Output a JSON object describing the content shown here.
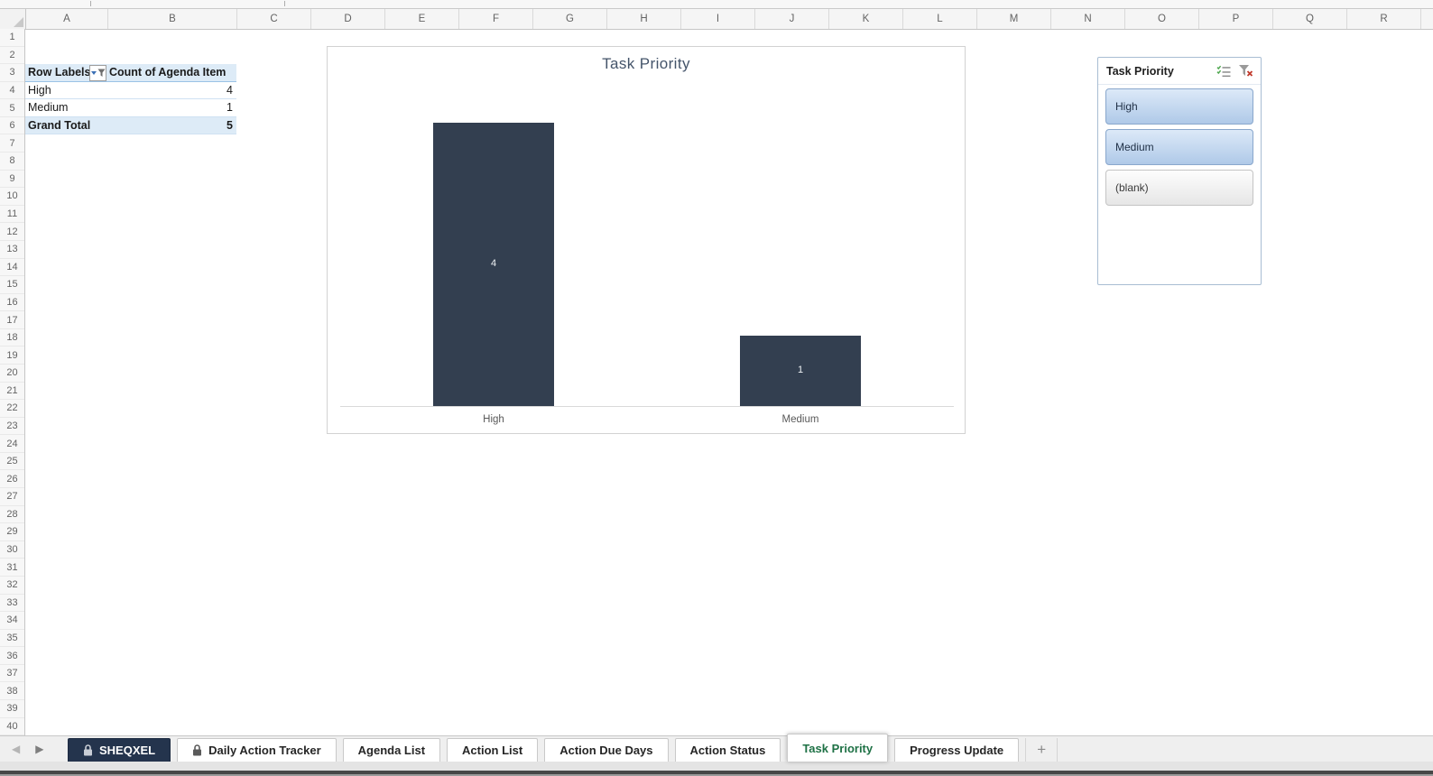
{
  "grid": {
    "columns": [
      "A",
      "B",
      "C",
      "D",
      "E",
      "F",
      "G",
      "H",
      "I",
      "J",
      "K",
      "L",
      "M",
      "N",
      "O",
      "P",
      "Q",
      "R"
    ],
    "rows": [
      1,
      2,
      3,
      4,
      5,
      6,
      7,
      8,
      9,
      10,
      11,
      12,
      13,
      14,
      15,
      16,
      17,
      18,
      19,
      20,
      21,
      22,
      23,
      24,
      25,
      26,
      27,
      28,
      29,
      30,
      31,
      32,
      33,
      34,
      35,
      36,
      37,
      38,
      39,
      40
    ]
  },
  "pivot": {
    "header": {
      "row_label": "Row Labels",
      "value_label": "Count of Agenda Item"
    },
    "rows": [
      {
        "label": "High",
        "value": "4"
      },
      {
        "label": "Medium",
        "value": "1"
      }
    ],
    "total": {
      "label": "Grand Total",
      "value": "5"
    }
  },
  "chart_data": {
    "type": "bar",
    "title": "Task Priority",
    "categories": [
      "High",
      "Medium"
    ],
    "values": [
      4,
      1
    ],
    "data_labels": [
      4,
      1
    ],
    "xlabel": "",
    "ylabel": "",
    "ylim": [
      0,
      4
    ],
    "gridlines": false,
    "y_axis_visible": false,
    "legend": "none",
    "bar_color": "#333F50"
  },
  "slicer": {
    "title": "Task Priority",
    "icons": [
      "multi-select-icon",
      "clear-filter-icon"
    ],
    "items": [
      {
        "label": "High",
        "selected": true
      },
      {
        "label": "Medium",
        "selected": true
      },
      {
        "label": "(blank)",
        "selected": false
      }
    ]
  },
  "sheet_tabs": {
    "tabs": [
      {
        "label": "SHEQXEL",
        "locked": true,
        "dark": true,
        "active": false
      },
      {
        "label": "Daily Action Tracker",
        "locked": true,
        "dark": false,
        "active": false
      },
      {
        "label": "Agenda List",
        "locked": false,
        "dark": false,
        "active": false
      },
      {
        "label": "Action List",
        "locked": false,
        "dark": false,
        "active": false
      },
      {
        "label": "Action Due Days",
        "locked": false,
        "dark": false,
        "active": false
      },
      {
        "label": "Action Status",
        "locked": false,
        "dark": false,
        "active": false
      },
      {
        "label": "Task Priority",
        "locked": false,
        "dark": false,
        "active": true
      },
      {
        "label": "Progress Update",
        "locked": false,
        "dark": false,
        "active": false
      }
    ],
    "add_label": "+"
  },
  "colors": {
    "bar": "#333F50",
    "active_tab_text": "#1E7145",
    "dark_tab_bg": "#24344D",
    "pivot_header_bg": "#DDEBF7",
    "slicer_selected_top": "#DCE9F8",
    "slicer_selected_bottom": "#AFC9E8",
    "chart_title_text": "#44546A"
  }
}
